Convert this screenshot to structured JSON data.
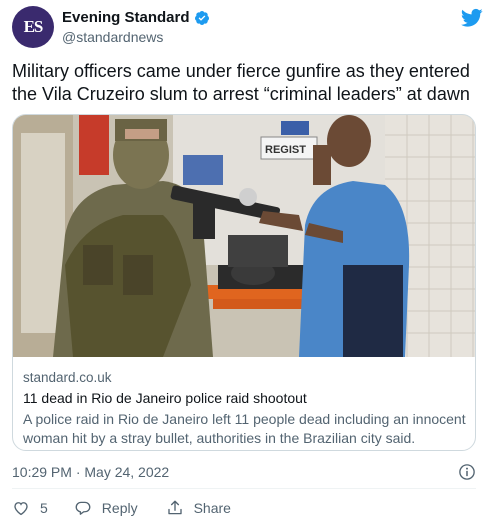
{
  "account": {
    "avatar_text": "ES",
    "display_name": "Evening Standard",
    "handle": "@standardnews",
    "verified": true
  },
  "tweet": {
    "text": "Military officers came under fierce gunfire as they entered the Vila Cruzeiro slum to arrest “criminal leaders” at dawn",
    "timestamp": "10:29 PM · May 24, 2022"
  },
  "card": {
    "domain": "standard.co.uk",
    "title": "11 dead in Rio de Janeiro police raid shootout",
    "description": "A police raid in Rio de Janeiro left 11 people dead including an innocent woman hit by a stray bullet, authorities in the Brazilian city said.",
    "image_sign_text": "REGIST"
  },
  "actions": {
    "like_count": "5",
    "reply_label": "Reply",
    "share_label": "Share"
  },
  "colors": {
    "brand_blue": "#1d9bf0",
    "text_primary": "#0f1419",
    "text_secondary": "#536471",
    "avatar_bg": "#3a2a6e"
  },
  "icons": [
    "verified-icon",
    "twitter-bird-icon",
    "info-icon",
    "heart-icon",
    "reply-icon",
    "share-icon"
  ]
}
